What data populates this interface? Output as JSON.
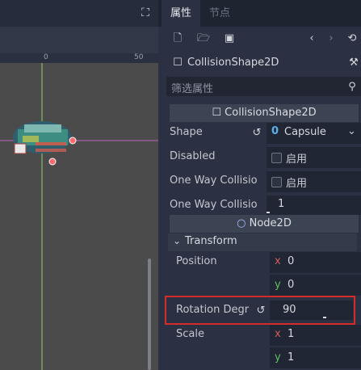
{
  "viewport": {
    "ruler_labels": [
      "0",
      "50"
    ]
  },
  "tabs": [
    {
      "label": "属性",
      "active": true
    },
    {
      "label": "节点",
      "active": false
    }
  ],
  "object": {
    "name": "CollisionShape2D"
  },
  "filter": {
    "placeholder": "筛选属性"
  },
  "sections": {
    "collision_header": "CollisionShape2D",
    "node2d_header": "Node2D",
    "transform_group": "Transform"
  },
  "properties": {
    "shape": {
      "label": "Shape",
      "value": "Capsule"
    },
    "disabled": {
      "label": "Disabled",
      "check_label": "启用"
    },
    "one_way": {
      "label": "One Way Collisio",
      "check_label": "启用"
    },
    "one_way_margin": {
      "label": "One Way Collisio",
      "value": "1"
    },
    "position": {
      "label": "Position",
      "x": "0",
      "y": "0"
    },
    "rotation": {
      "label": "Rotation Degr",
      "value": "90"
    },
    "scale": {
      "label": "Scale",
      "x": "1",
      "y": "1"
    }
  },
  "axis_labels": {
    "x": "x",
    "y": "y"
  }
}
